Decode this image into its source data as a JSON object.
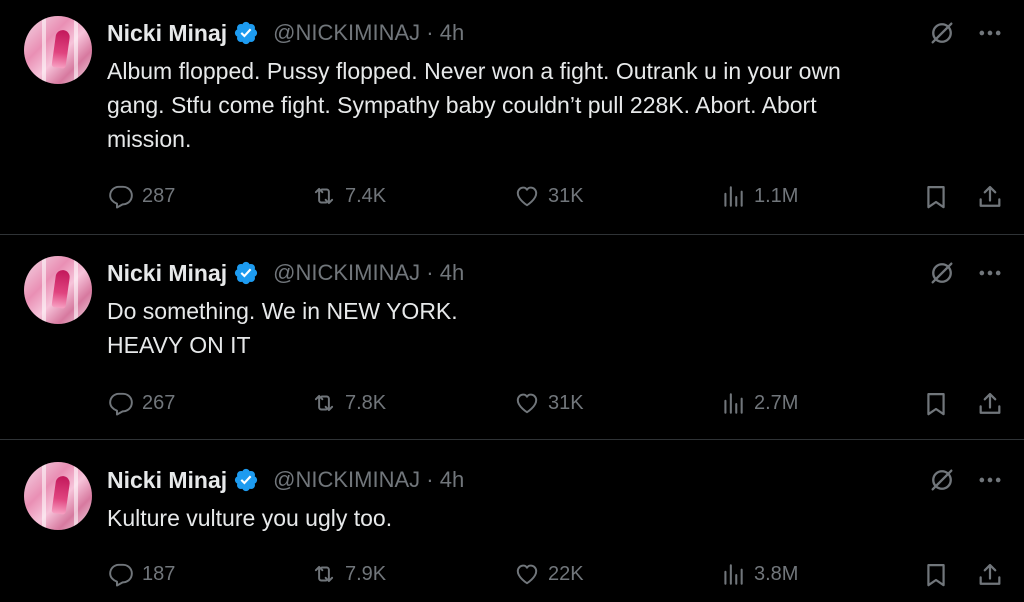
{
  "tweets": [
    {
      "author_name": "Nicki Minaj",
      "handle_time": "@NICKIMINAJ · 4h",
      "text": "Album flopped. Pussy flopped. Never won a fight. Outrank u in your own\ngang. Stfu come fight. Sympathy baby couldn’t pull 228K. Abort. Abort\nmission.",
      "replies": "287",
      "retweets": "7.4K",
      "likes": "31K",
      "views": "1.1M"
    },
    {
      "author_name": "Nicki Minaj",
      "handle_time": "@NICKIMINAJ · 4h",
      "text": "Do something. We in NEW YORK.\nHEAVY ON IT",
      "replies": "267",
      "retweets": "7.8K",
      "likes": "31K",
      "views": "2.7M"
    },
    {
      "author_name": "Nicki Minaj",
      "handle_time": "@NICKIMINAJ · 4h",
      "text": "Kulture vulture you ugly too.",
      "replies": "187",
      "retweets": "7.9K",
      "likes": "22K",
      "views": "3.8M"
    }
  ],
  "icons": {
    "verified": "verified-badge-icon",
    "grok": "grok-icon",
    "more": "more-dots-icon",
    "reply": "reply-bubble-icon",
    "retweet": "retweet-arrows-icon",
    "like": "heart-icon",
    "views": "views-bars-icon",
    "bookmark": "bookmark-icon",
    "share": "share-upload-icon"
  },
  "colors": {
    "background": "#000000",
    "text_primary": "#e7e9ea",
    "text_secondary": "#71767b",
    "verified_blue": "#1d9bf0",
    "divider": "#2f3336"
  }
}
